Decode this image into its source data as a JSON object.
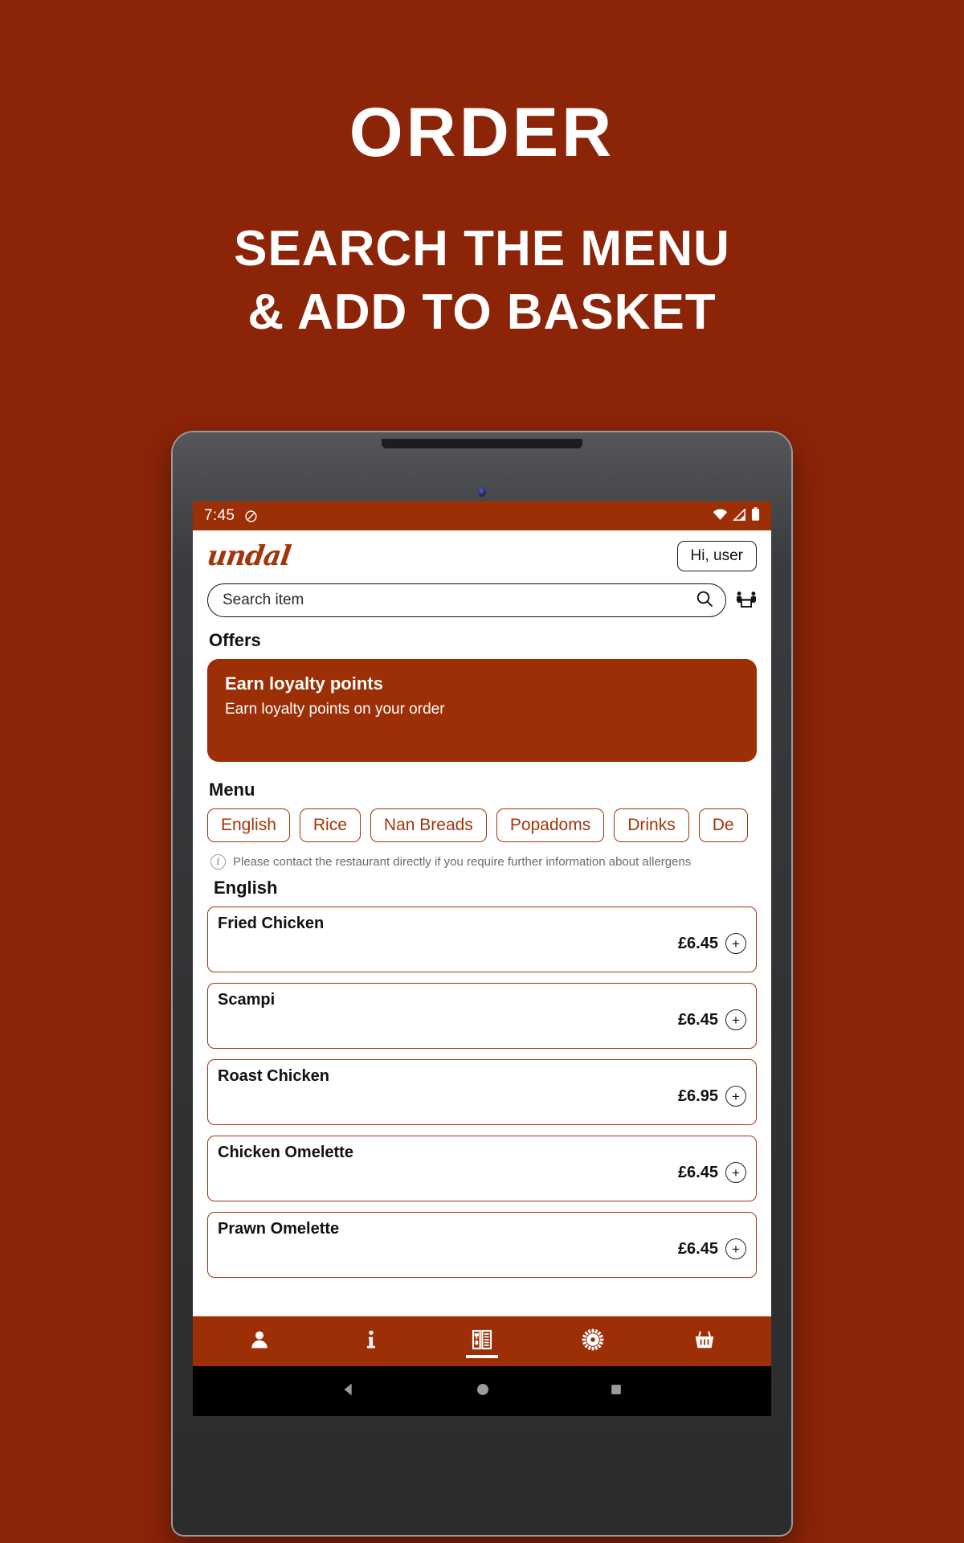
{
  "promo": {
    "title": "ORDER",
    "subtitle_line1": "SEARCH THE MENU",
    "subtitle_line2": "& ADD TO BASKET",
    "background_color": "#8C2408",
    "text_color": "#FFFFFF"
  },
  "brand": {
    "accent_color": "#A2350A",
    "statusbar_color": "#9C2F06"
  },
  "status_bar": {
    "time": "7:45",
    "icons": [
      "do-not-disturb-icon",
      "wifi-icon",
      "signal-icon",
      "battery-icon"
    ]
  },
  "app_header": {
    "logo_text": "undal",
    "account_button": "Hi, user"
  },
  "search": {
    "placeholder": "Search item",
    "value": "",
    "search_icon": "search-icon",
    "table_booking_icon": "table-booking-icon"
  },
  "offers": {
    "heading": "Offers",
    "card": {
      "title": "Earn loyalty points",
      "subtitle": "Earn loyalty points on your order"
    }
  },
  "menu": {
    "heading": "Menu",
    "categories": [
      {
        "label": "English"
      },
      {
        "label": "Rice"
      },
      {
        "label": "Nan Breads"
      },
      {
        "label": "Popadoms"
      },
      {
        "label": "Drinks"
      },
      {
        "label": "De"
      }
    ],
    "allergen_notice": "Please contact the restaurant directly if you require further information about allergens",
    "current_category": "English",
    "items": [
      {
        "name": "Fried Chicken",
        "price": "£6.45",
        "add": "+"
      },
      {
        "name": "Scampi",
        "price": "£6.45",
        "add": "+"
      },
      {
        "name": "Roast Chicken",
        "price": "£6.95",
        "add": "+"
      },
      {
        "name": "Chicken Omelette",
        "price": "£6.45",
        "add": "+"
      },
      {
        "name": "Prawn Omelette",
        "price": "£6.45",
        "add": "+"
      }
    ]
  },
  "bottom_nav": [
    {
      "icon": "account-icon",
      "active": false
    },
    {
      "icon": "info-icon",
      "active": false
    },
    {
      "icon": "menu-book-icon",
      "active": true
    },
    {
      "icon": "settings-gear-icon",
      "active": false
    },
    {
      "icon": "basket-icon",
      "active": false
    }
  ],
  "system_nav": [
    {
      "icon": "back-triangle-icon"
    },
    {
      "icon": "home-circle-icon"
    },
    {
      "icon": "recents-square-icon"
    }
  ]
}
